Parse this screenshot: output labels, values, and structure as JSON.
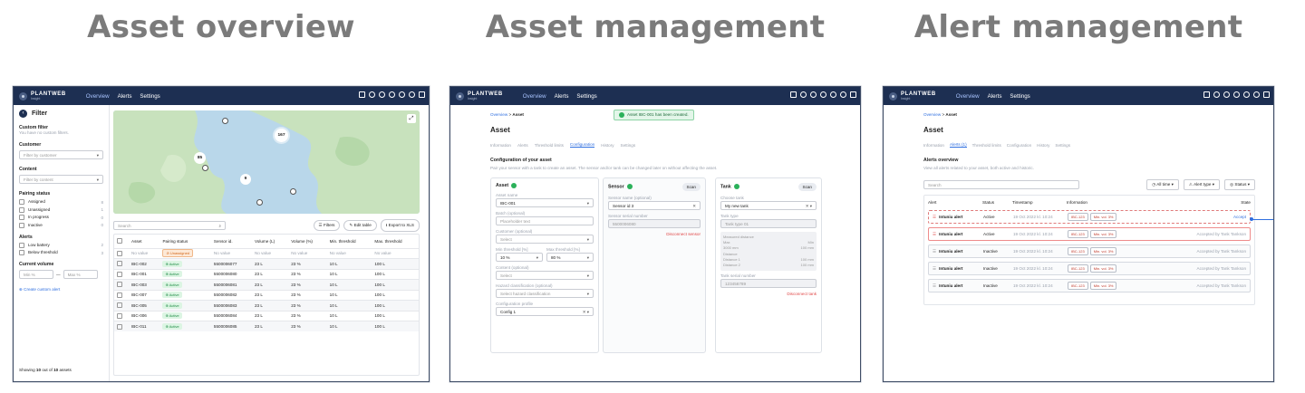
{
  "headings": {
    "overview": "Asset overview",
    "management": "Asset management",
    "alerts": "Alert management"
  },
  "app": {
    "brand": "PLANTWEB",
    "sub": "Insight",
    "nav": [
      "Overview",
      "Alerts",
      "Settings"
    ]
  },
  "overview": {
    "filter_title": "Filter",
    "custom_filter": "Custom filter",
    "custom_filter_hint": "You have no custom filters.",
    "customer_label": "Customer",
    "customer_placeholder": "Filter by customer",
    "content_label": "Content",
    "content_placeholder": "Filter by content",
    "pairing_label": "Pairing status",
    "pairing_items": [
      {
        "label": "Assigned",
        "count": "8"
      },
      {
        "label": "Unassigned",
        "count": "1"
      },
      {
        "label": "In progress",
        "count": "0"
      },
      {
        "label": "Inactive",
        "count": "0"
      }
    ],
    "alerts_label": "Alerts",
    "alerts_items": [
      {
        "label": "Low battery",
        "count": "2"
      },
      {
        "label": "Below threshold",
        "count": "3"
      }
    ],
    "volume_label": "Current volume",
    "min_placeholder": "Min %",
    "max_placeholder": "Max %",
    "create_alert": "Create custom alert",
    "showing_pre": "Showing",
    "showing_n": "10",
    "showing_mid": "out of",
    "showing_total": "10",
    "showing_post": "assets",
    "map_markers": [
      "167",
      "85",
      "9"
    ],
    "search_placeholder": "Search",
    "btn_filters": "Filters",
    "btn_edit": "Edit table",
    "btn_export": "Export to XLS",
    "columns": [
      "Asset",
      "Pairing status",
      "Sensor id.",
      "Volume (L)",
      "Volume (%)",
      "Min. threshold",
      "Max. threshold"
    ],
    "rows": [
      {
        "asset": "No value",
        "status": "Unassigned",
        "sensor": "No value",
        "vol": "No value",
        "pct": "No value",
        "min": "No value",
        "max": "No value",
        "type": "unassigned"
      },
      {
        "asset": "IBC-002",
        "status": "Active",
        "sensor": "5500006077",
        "vol": "23 L",
        "pct": "23 %",
        "min": "10 L",
        "max": "100 L",
        "type": "active"
      },
      {
        "asset": "IBC-001",
        "status": "Active",
        "sensor": "5500006080",
        "vol": "23 L",
        "pct": "23 %",
        "min": "10 L",
        "max": "100 L",
        "type": "active"
      },
      {
        "asset": "IBC-003",
        "status": "Active",
        "sensor": "5500006081",
        "vol": "23 L",
        "pct": "23 %",
        "min": "10 L",
        "max": "100 L",
        "type": "active"
      },
      {
        "asset": "IBC-007",
        "status": "Active",
        "sensor": "5500006082",
        "vol": "23 L",
        "pct": "23 %",
        "min": "10 L",
        "max": "100 L",
        "type": "active"
      },
      {
        "asset": "IBC-005",
        "status": "Active",
        "sensor": "5500006083",
        "vol": "23 L",
        "pct": "23 %",
        "min": "10 L",
        "max": "100 L",
        "type": "active"
      },
      {
        "asset": "IBC-006",
        "status": "Active",
        "sensor": "5500006084",
        "vol": "23 L",
        "pct": "23 %",
        "min": "10 L",
        "max": "100 L",
        "type": "active"
      },
      {
        "asset": "IBC-011",
        "status": "Active",
        "sensor": "5500006085",
        "vol": "23 L",
        "pct": "23 %",
        "min": "10 L",
        "max": "100 L",
        "type": "active"
      }
    ]
  },
  "management": {
    "breadcrumb_root": "Overview",
    "breadcrumb_current": "Asset",
    "toast": "Asset IBC-001 has been created.",
    "title": "Asset",
    "tabs": [
      "Information",
      "Alerts",
      "Threshold limits",
      "Configuration",
      "History",
      "Settings"
    ],
    "active_tab": 3,
    "section_title": "Configuration of your asset",
    "section_desc": "Pair your sensor with a tank to create an asset. The sensor and/or tank can be changed later on without affecting the asset.",
    "asset_col": {
      "title": "Asset",
      "name_label": "Asset name",
      "name_value": "IBC-001",
      "batch_label": "Batch (optional)",
      "batch_placeholder": "Placeholder text",
      "customer_label": "Customer (optional)",
      "customer_placeholder": "Select",
      "min_label": "Min threshold [%]",
      "min_value": "10 %",
      "max_label": "Max threshold [%]",
      "max_value": "80 %",
      "content_label": "Content (optional)",
      "content_placeholder": "Select",
      "hazard_label": "Hazard classification (optional)",
      "hazard_placeholder": "Select hazard classification",
      "config_label": "Configuration profile",
      "config_value": "Config 1"
    },
    "sensor_col": {
      "title": "Sensor",
      "scan": "Scan",
      "name_label": "Sensor name (optional)",
      "name_value": "Sensor id 3",
      "serial_label": "Sensor serial number",
      "serial_value": "5500006080",
      "disconnect": "Disconnect sensor"
    },
    "tank_col": {
      "title": "Tank",
      "scan": "Scan",
      "choose_label": "Choose tank",
      "choose_value": "My new tank",
      "type_label": "Tank type",
      "type_value": "Tank type 01",
      "measured_label": "Measured distance",
      "max_label": "Max",
      "max_value": "3000 mm",
      "min_label": "Min",
      "min_value": "100 mm",
      "distance_label": "Distance",
      "d1_label": "Distance 1",
      "d1_value": "100 mm",
      "d2_label": "Distance 2",
      "d2_value": "100 mm",
      "serial_label": "Tank serial number",
      "serial_value": "123456789",
      "disconnect": "Disconnect tank"
    }
  },
  "alerts": {
    "breadcrumb_root": "Overview",
    "breadcrumb_current": "Asset",
    "title": "Asset",
    "tabs": [
      "Information",
      "Alerts (1)",
      "Threshold limits",
      "Configuration",
      "History",
      "Settings"
    ],
    "active_tab": 1,
    "section_title": "Alerts overview",
    "section_desc": "View all alerts related to your asset, both active and historic.",
    "search_placeholder": "Search",
    "filter_time": "All time",
    "filter_type": "Alert type",
    "filter_status": "Status",
    "columns": [
      "Alert",
      "Status",
      "Timestamp",
      "Information",
      "State"
    ],
    "chip_asset": "IBC-123",
    "chip_vol": "Min. vol. 3%",
    "rows": [
      {
        "name": "Intuniu alert",
        "status": "Active",
        "time": "19 Oct 2022 kl. 10:24",
        "state": "Accept",
        "kind": "active-selected"
      },
      {
        "name": "Intuniu alert",
        "status": "Active",
        "time": "19 Oct 2022 kl. 10:24",
        "state": "Accepted by Tank Tankson",
        "kind": "active"
      },
      {
        "name": "Intuniu alert",
        "status": "Inactive",
        "time": "19 Oct 2022 kl. 10:24",
        "state": "Accepted by Tank Tankson",
        "kind": "inactive"
      },
      {
        "name": "Intuniu alert",
        "status": "Inactive",
        "time": "19 Oct 2022 kl. 10:24",
        "state": "Accepted by Tank Tankson",
        "kind": "inactive"
      },
      {
        "name": "Intuniu alert",
        "status": "Inactive",
        "time": "19 Oct 2022 kl. 10:24",
        "state": "Accepted by Tank Tankson",
        "kind": "inactive"
      }
    ]
  },
  "colors": {
    "topbar": "#1d2f52",
    "accent": "#2f6fe0",
    "alert_red": "#e04848",
    "ok_green": "#2bb15a",
    "heading_gray": "#7b7b7b"
  }
}
